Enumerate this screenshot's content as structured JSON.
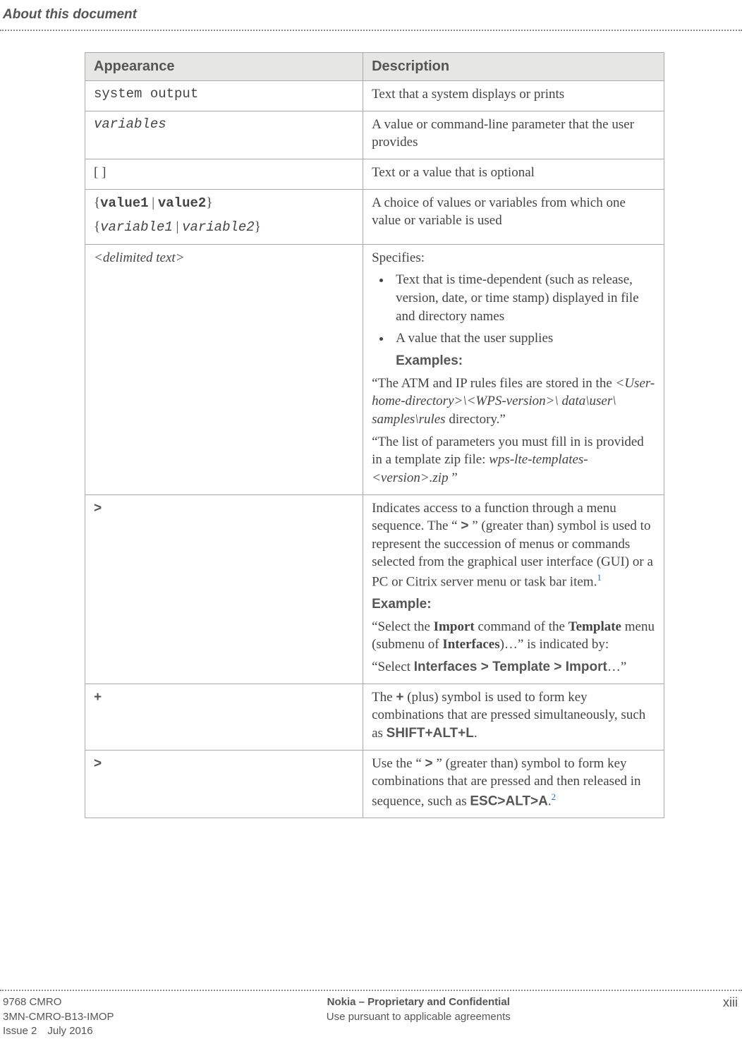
{
  "header": {
    "title": "About this document"
  },
  "table": {
    "headers": {
      "col1": "Appearance",
      "col2": "Description"
    },
    "rows": {
      "r1": {
        "appearance": "system output",
        "desc": "Text that a system displays or prints"
      },
      "r2": {
        "appearance": "variables",
        "desc": "A value or command-line parameter that the user provides"
      },
      "r3": {
        "appearance": "[ ]",
        "desc": "Text or a value that is optional"
      },
      "r4": {
        "line1_open": "{",
        "line1_v1": "value1",
        "line1_sep": " | ",
        "line1_v2": "value2",
        "line1_close": "}",
        "line2_open": "{",
        "line2_v1": "variable1",
        "line2_sep": " | ",
        "line2_v2": "variable2",
        "line2_close": "}",
        "desc": "A choice of values or variables from which one value or variable is used"
      },
      "r5": {
        "app_open": "<",
        "app_text": "delimited text",
        "app_close": ">",
        "spec": "Specifies:",
        "b1": "Text that is time-dependent (such as release, version, date, or time stamp) displayed in file and directory names",
        "b2": "A value that the user supplies",
        "examples_label": "Examples:",
        "ex1_pre": "“The ATM and IP rules files are stored in the ",
        "ex1_it1": "<User-home-directory>\\<WPS-version>\\ data\\user\\ samples\\rules",
        "ex1_post": " directory.”",
        "ex2_pre": "“The list of parameters you must fill in is provided in a template zip file: ",
        "ex2_it1": "wps-lte-templates-<version>.zip",
        "ex2_post": " ”"
      },
      "r6": {
        "appearance": ">",
        "d1a": "Indicates access to a function through a menu sequence. The “ ",
        "d1b": ">",
        "d1c": " ” (greater than) symbol is used to represent the succession of menus or commands selected from the graphical user interface (GUI) or a PC or Citrix server menu or task bar item.",
        "sup1": "1",
        "example_label": "Example:",
        "ex_a": "“Select the ",
        "ex_b": "Import",
        "ex_c": " command of the ",
        "ex_d": "Template",
        "ex_e": " menu (submenu of ",
        "ex_f": "Interfaces",
        "ex_g": ")…” is indicated by:",
        "ex2_a": "“Select ",
        "ex2_b": "Interfaces > Template > Import",
        "ex2_c": "…”"
      },
      "r7": {
        "appearance": "+",
        "d_a": "The ",
        "d_b": "+",
        "d_c": " (plus) symbol is used to form key combinations that are pressed simultaneously, such as ",
        "d_d": "SHIFT+ALT+L",
        "d_e": "."
      },
      "r8": {
        "appearance": ">",
        "d_a": "Use the “ ",
        "d_b": ">",
        "d_c": " ” (greater than) symbol to form key combinations that are pressed and then released in sequence, such as ",
        "d_d": "ESC>ALT>A",
        "d_e": ".",
        "sup2": "2"
      }
    }
  },
  "footer": {
    "left1": "9768 CMRO",
    "left2": "3MN-CMRO-B13-IMOP",
    "left3": "Issue 2 July 2016",
    "center1": "Nokia – Proprietary and Confidential",
    "center2": "Use pursuant to applicable agreements",
    "right": "xiii"
  }
}
